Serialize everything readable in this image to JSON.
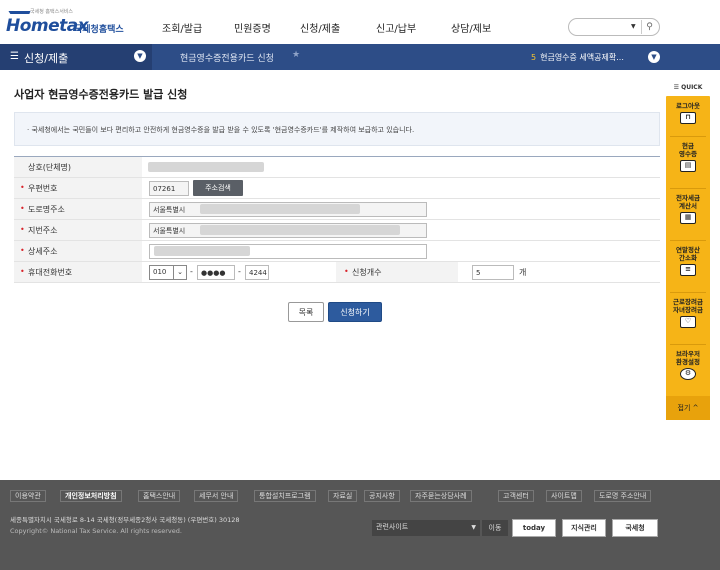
{
  "header": {
    "logo_sub": "국세청 홈택스서비스",
    "logo_main": "Hometax",
    "logo_kr": "국세청홈택스",
    "menu": [
      "조회/발급",
      "민원증명",
      "신청/제출",
      "신고/납부",
      "상담/제보"
    ],
    "search_placeholder": ""
  },
  "nav": {
    "menu_title": "신청/제출",
    "breadcrumb": "현금영수증전용카드 신청",
    "right_num": "5",
    "right_text": "현금영수증 세액공제확..."
  },
  "page": {
    "title": "사업자 현금영수증전용카드 발급 신청",
    "notice": "· 국세청에서는 국민들이 보다 편리하고 안전하게 현금영수증을 발급 받을 수 있도록 '현금영수증카드'를 제작하여 보급하고 있습니다."
  },
  "form": {
    "company_label": "상호(단체명)",
    "zip_label": "우편번호",
    "zip_value": "07261",
    "addr_search_label": "주소검색",
    "road_label": "도로명주소",
    "road_value": "서울특별시",
    "lot_label": "지번주소",
    "lot_value": "서울특별시",
    "detail_label": "상세주소",
    "phone_label": "휴대전화번호",
    "phone1": "010",
    "phone2": "●●●●",
    "phone3": "4244",
    "dash": "-",
    "count_label": "신청개수",
    "count_value": "5",
    "count_unit": "개"
  },
  "buttons": {
    "list": "목록",
    "apply": "신청하기"
  },
  "quick": {
    "head": "QUICK",
    "items": [
      "로그아웃",
      "현금\n영수증",
      "전자세금\n계산서",
      "연말정산\n간소화",
      "근로장려금\n자녀장려금",
      "브라우저\n환경설정"
    ],
    "close": "접기 ^"
  },
  "footer": {
    "links": [
      "이용약관",
      "개인정보처리방침",
      "홈택스안내",
      "세무서 안내",
      "통합설치프로그램",
      "자료실",
      "공지사항",
      "자주묻는상담사례",
      "고객센터",
      "사이트맵",
      "도로명 주소안내"
    ],
    "address": "세종특별자치시 국세청로 8-14 국세청(정부세종2청사 국세청동) (우편번호) 30128",
    "copyright": "Copyright© National Tax Service. All rights reserved.",
    "related": "관련사이트",
    "go": "이동",
    "banners": [
      "today",
      "지식관리",
      "국세청"
    ]
  }
}
